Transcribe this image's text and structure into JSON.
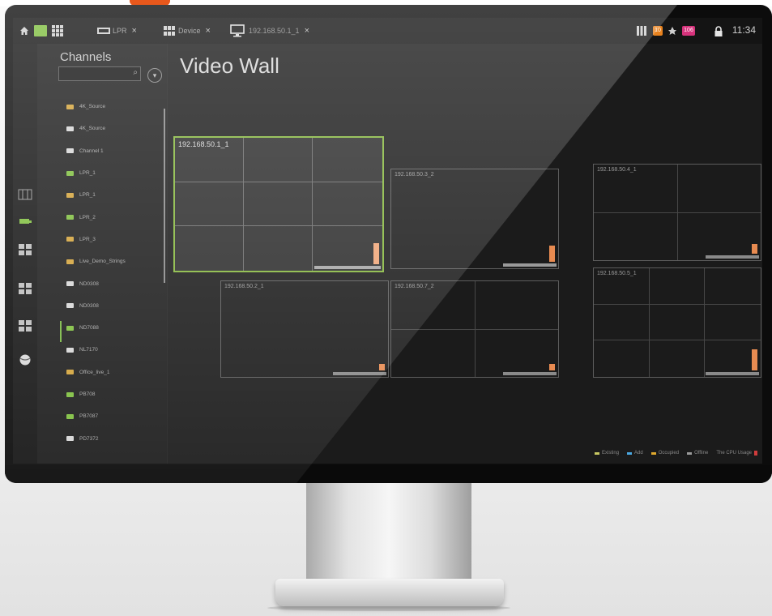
{
  "topbar": {
    "tabs": [
      {
        "label": "LPR",
        "icon": "lpr-icon"
      },
      {
        "label": "Device",
        "icon": "device-grid-icon"
      },
      {
        "label": "192.168.50.1_1",
        "icon": "monitor-icon"
      }
    ],
    "close_glyph": "×",
    "status_badges": [
      {
        "icon": "server-icon",
        "count": ""
      },
      {
        "icon": "event-icon",
        "count": "10",
        "color": "#e8821e"
      },
      {
        "icon": "alarm-icon",
        "count": ""
      },
      {
        "icon": "message-icon",
        "count": "106",
        "color": "#d6337c"
      }
    ],
    "clock": "11:34"
  },
  "channels": {
    "title": "Channels",
    "search_placeholder": "",
    "items": [
      {
        "label": "4K_Source",
        "kind": "dome"
      },
      {
        "label": "4K_Source",
        "kind": "bullet"
      },
      {
        "label": "Channel 1",
        "kind": "bullet"
      },
      {
        "label": "LPR_1",
        "kind": "bullet-green"
      },
      {
        "label": "LPR_1",
        "kind": "dome"
      },
      {
        "label": "LPR_2",
        "kind": "bullet-green"
      },
      {
        "label": "LPR_3",
        "kind": "dome"
      },
      {
        "label": "Live_Demo_Strings",
        "kind": "dome"
      },
      {
        "label": "ND0308",
        "kind": "bullet"
      },
      {
        "label": "ND0308",
        "kind": "bullet"
      },
      {
        "label": "ND7088",
        "kind": "bullet-green"
      },
      {
        "label": "NL7170",
        "kind": "bullet"
      },
      {
        "label": "Office_live_1",
        "kind": "dome"
      },
      {
        "label": "PB708",
        "kind": "bullet-green"
      },
      {
        "label": "PB7087",
        "kind": "bullet-green"
      },
      {
        "label": "PD7372",
        "kind": "bullet"
      }
    ]
  },
  "rail": [
    "grid-view-icon",
    "camera-icon",
    "layout-icon",
    "layout-icon",
    "layout-icon",
    "globe-icon"
  ],
  "main": {
    "title": "Video Wall",
    "walls": [
      {
        "label": "192.168.50.1_1",
        "selected": true
      },
      {
        "label": "192.168.50.3_2",
        "selected": false
      },
      {
        "label": "192.168.50.4_1",
        "selected": false
      },
      {
        "label": "192.168.50.2_1",
        "selected": false
      },
      {
        "label": "192.168.50.7_2",
        "selected": false
      },
      {
        "label": "192.168.50.5_1",
        "selected": false
      }
    ],
    "legend": [
      {
        "label": "Existing",
        "color": "#c8c862"
      },
      {
        "label": "Add",
        "color": "#4aa7e0"
      },
      {
        "label": "Occupied",
        "color": "#e0a92e"
      },
      {
        "label": "Offline",
        "color": "#9a9a9a"
      },
      {
        "label": "The CPU Usage",
        "color": "#d03c3c"
      }
    ]
  }
}
